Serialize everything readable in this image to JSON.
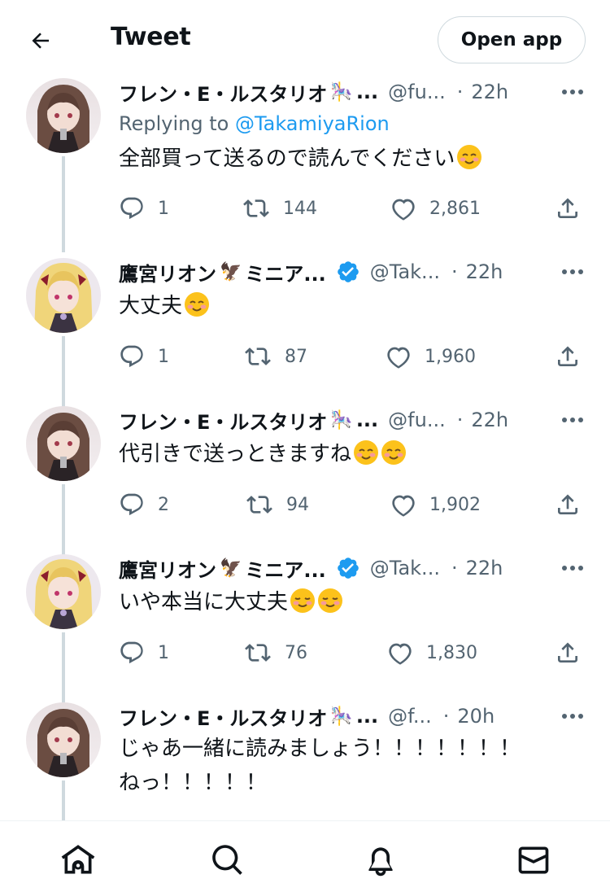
{
  "header": {
    "title": "Tweet",
    "open_app_label": "Open app"
  },
  "tweets": [
    {
      "name": "フレン・E・ルスタリオ",
      "name_emoji": "🎠",
      "name_trunc": "...",
      "handle": "@fu...",
      "dot": "·",
      "time": "22h",
      "reply_prefix": "Replying to ",
      "reply_mention": "@TakamiyaRion",
      "text": "全部買って送るので読んでください",
      "text_emojis": [
        "😊"
      ],
      "replies": "1",
      "retweets": "144",
      "likes": "2,861"
    },
    {
      "name": "鷹宮リオン",
      "name_emoji": "🦅",
      "name_suffix": "ミニア...",
      "verified": true,
      "handle": "@Tak...",
      "dot": "·",
      "time": "22h",
      "text": "大丈夫",
      "text_emojis": [
        "😊"
      ],
      "replies": "1",
      "retweets": "87",
      "likes": "1,960"
    },
    {
      "name": "フレン・E・ルスタリオ",
      "name_emoji": "🎠",
      "name_trunc": "...",
      "handle": "@fu...",
      "dot": "·",
      "time": "22h",
      "text": "代引きで送っときますね",
      "text_emojis": [
        "😊",
        "😊"
      ],
      "replies": "2",
      "retweets": "94",
      "likes": "1,902"
    },
    {
      "name": "鷹宮リオン",
      "name_emoji": "🦅",
      "name_suffix": "ミニア...",
      "verified": true,
      "handle": "@Tak...",
      "dot": "·",
      "time": "22h",
      "text": "いや本当に大丈夫",
      "text_emojis": [
        "☺️",
        "☺️"
      ],
      "replies": "1",
      "retweets": "76",
      "likes": "1,830"
    },
    {
      "name": "フレン・E・ルスタリオ",
      "name_emoji": "🎠",
      "name_trunc": "...",
      "handle": "@f...",
      "dot": "·",
      "time": "20h",
      "text_line1": "じゃあ一緒に読みましょう！！！！！！！",
      "text_line2": "ねっ！！！！！"
    }
  ],
  "icons": {
    "back": "arrow-left-icon",
    "more": "more-dots-icon",
    "reply": "reply-bubble-icon",
    "retweet": "retweet-icon",
    "like": "heart-icon",
    "share": "share-icon",
    "verified": "verified-badge-icon",
    "nav": [
      "home-icon",
      "search-icon",
      "notifications-icon",
      "messages-icon"
    ]
  },
  "colors": {
    "accent": "#1d9bf0",
    "secondary_text": "#536471",
    "thread_line": "#cfd9de"
  }
}
